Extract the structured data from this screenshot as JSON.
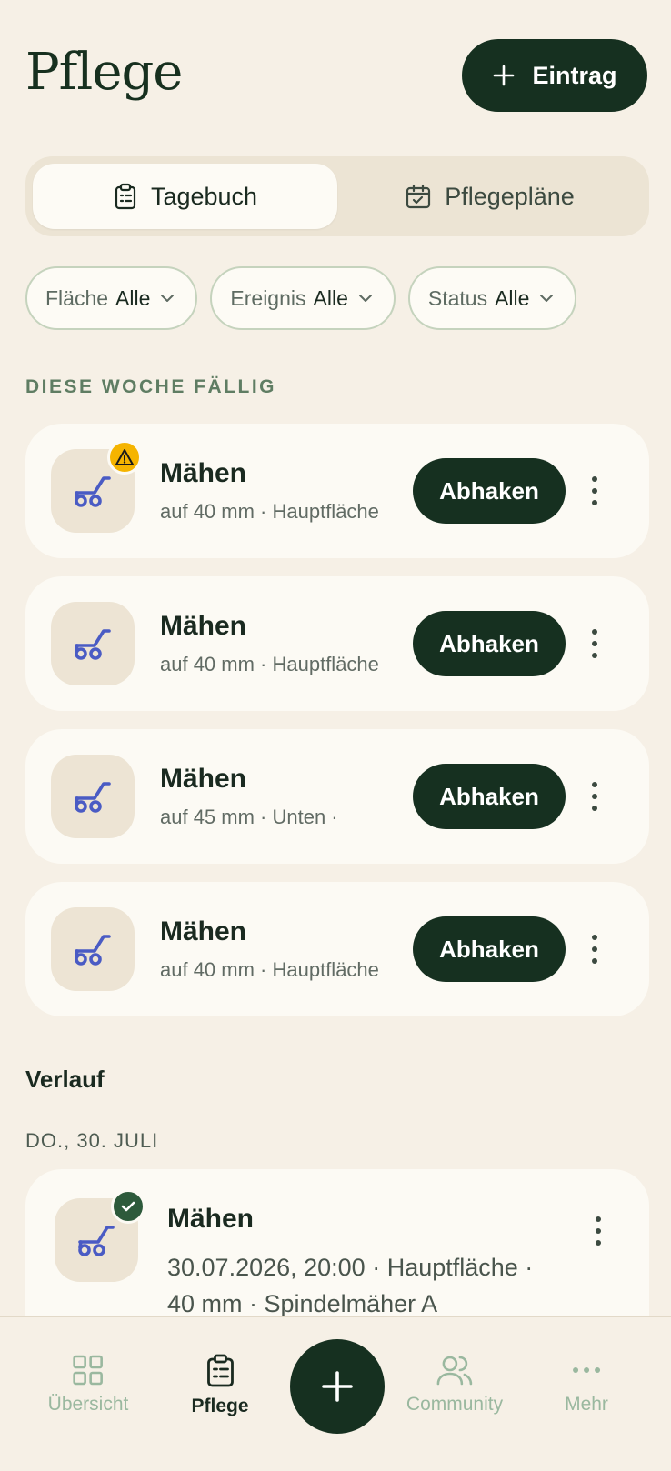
{
  "header": {
    "title": "Pflege",
    "add_label": "Eintrag"
  },
  "segment": {
    "tabs": [
      {
        "label": "Tagebuch",
        "active": true
      },
      {
        "label": "Pflegepläne",
        "active": false
      }
    ]
  },
  "filters": [
    {
      "label": "Fläche",
      "value": "Alle"
    },
    {
      "label": "Ereignis",
      "value": "Alle"
    },
    {
      "label": "Status",
      "value": "Alle"
    }
  ],
  "due": {
    "section_label": "DIESE WOCHE FÄLLIG",
    "action_label": "Abhaken",
    "tasks": [
      {
        "title": "Mähen",
        "subtitle": "auf 40 mm · Hauptfläche",
        "warning": true
      },
      {
        "title": "Mähen",
        "subtitle": "auf 40 mm · Hauptfläche",
        "warning": false
      },
      {
        "title": "Mähen",
        "subtitle": "auf 45 mm · Unten · ",
        "warning": false
      },
      {
        "title": "Mähen",
        "subtitle": "auf 40 mm · Hauptfläche",
        "warning": false
      }
    ]
  },
  "history": {
    "title": "Verlauf",
    "date_label": "DO., 30. JULI",
    "entries": [
      {
        "title": "Mähen",
        "subtitle": "30.07.2026, 20:00 · Hauptfläche · 40 mm · Spindelmäher A"
      }
    ]
  },
  "nav": {
    "items": [
      {
        "label": "Übersicht",
        "icon": "grid-icon"
      },
      {
        "label": "Pflege",
        "icon": "clipboard-icon",
        "active": true
      },
      {
        "label": "Community",
        "icon": "users-icon"
      },
      {
        "label": "Mehr",
        "icon": "more-horizontal-icon"
      }
    ]
  },
  "colors": {
    "accent": "#163020",
    "background": "#f6f0e6",
    "card": "#fcfaf4",
    "warning": "#f5b400",
    "success": "#2d5a3b",
    "mower_icon": "#4a5bc4"
  }
}
